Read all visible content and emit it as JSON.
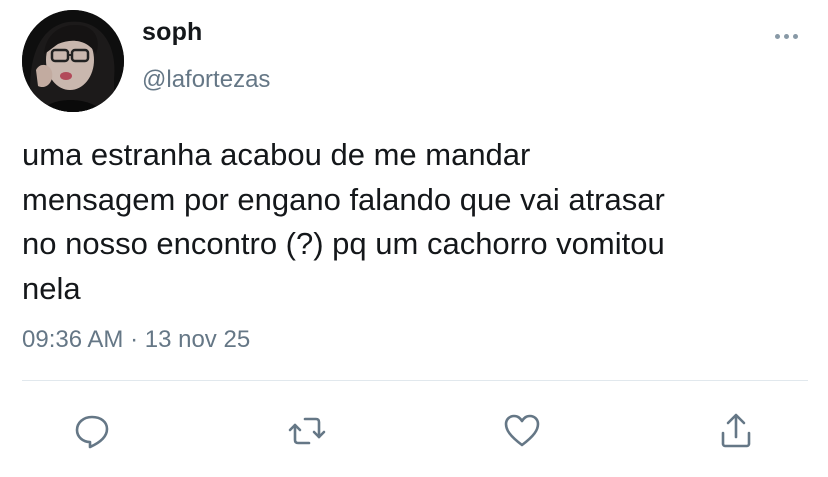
{
  "tweet": {
    "display_name": "soph",
    "handle": "@lafortezas",
    "text": "uma estranha acabou de me mandar\nmensagem por engano falando que vai atrasar\nno nosso encontro (?) pq um cachorro vomitou\nnela",
    "time": "09:36 AM",
    "separator": "·",
    "date": "13 nov 25"
  },
  "icons": {
    "more": "more-options-icon",
    "reply": "reply-icon",
    "retweet": "retweet-icon",
    "like": "like-icon",
    "share": "share-icon"
  },
  "colors": {
    "text": "#14171a",
    "secondary": "#657786",
    "icon": "#657786",
    "divider": "#e1e8ed"
  }
}
